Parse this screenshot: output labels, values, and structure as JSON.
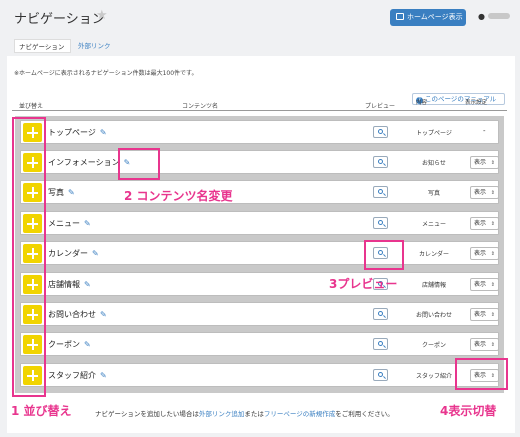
{
  "header": {
    "title": "ナビゲーション",
    "star_icon": "star-icon",
    "home_button_label": "ホームページ表示",
    "user_icon": "user-icon"
  },
  "tabs": [
    {
      "label": "ナビゲーション",
      "active": true
    },
    {
      "label": "外部リンク",
      "active": false
    }
  ],
  "notice": "※ホームページに表示されるナビゲーション件数は最大100件です。",
  "manual_link": "このページのマニュアル",
  "table": {
    "headers": {
      "sort": "並び替え",
      "name": "コンテンツ名",
      "preview": "プレビュー",
      "content": "内容",
      "visibility": "表示設定"
    },
    "rows": [
      {
        "name": "トップページ",
        "content": "トップページ",
        "visibility": "-"
      },
      {
        "name": "インフォメーション",
        "content": "お知らせ",
        "visibility": "表示"
      },
      {
        "name": "写真",
        "content": "写真",
        "visibility": "表示"
      },
      {
        "name": "メニュー",
        "content": "メニュー",
        "visibility": "表示"
      },
      {
        "name": "カレンダー",
        "content": "カレンダー",
        "visibility": "表示"
      },
      {
        "name": "店舗情報",
        "content": "店舗情報",
        "visibility": "表示"
      },
      {
        "name": "お問い合わせ",
        "content": "お問い合わせ",
        "visibility": "表示"
      },
      {
        "name": "クーポン",
        "content": "クーポン",
        "visibility": "表示"
      },
      {
        "name": "スタッフ紹介",
        "content": "スタッフ紹介",
        "visibility": "表示"
      }
    ]
  },
  "footer": {
    "text_before": "ナビゲーションを追加したい場合は",
    "link1": "外部リンク追加",
    "text_middle": "または",
    "link2": "フリーページの新規作成",
    "text_after": "をご利用ください。"
  },
  "annotations": {
    "a1": "1 並び替え",
    "a2": "2 コンテンツ名変更",
    "a3": "3プレビュー",
    "a4": "4表示切替"
  },
  "colors": {
    "accent": "#3a7fc1",
    "handle": "#f1d400",
    "annotation": "#e8358e"
  }
}
